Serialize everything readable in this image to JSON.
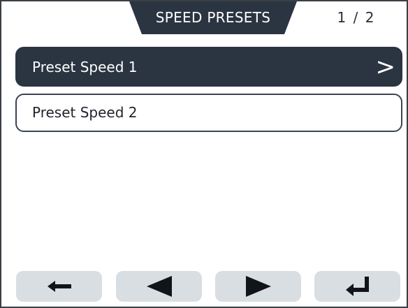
{
  "header": {
    "title": "SPEED PRESETS",
    "page_indicator": "1 / 2",
    "tab_color": "#2b3541"
  },
  "list": {
    "items": [
      {
        "label": "Preset Speed 1",
        "selected": true,
        "arrow": ">"
      },
      {
        "label": "Preset Speed 2",
        "selected": false
      }
    ]
  },
  "footer": {
    "buttons": [
      {
        "icon": "back-arrow-icon"
      },
      {
        "icon": "triangle-left-icon"
      },
      {
        "icon": "triangle-right-icon"
      },
      {
        "icon": "enter-return-icon"
      }
    ]
  },
  "colors": {
    "selected_bg": "#2b3541",
    "button_bg": "#d9dee3"
  }
}
